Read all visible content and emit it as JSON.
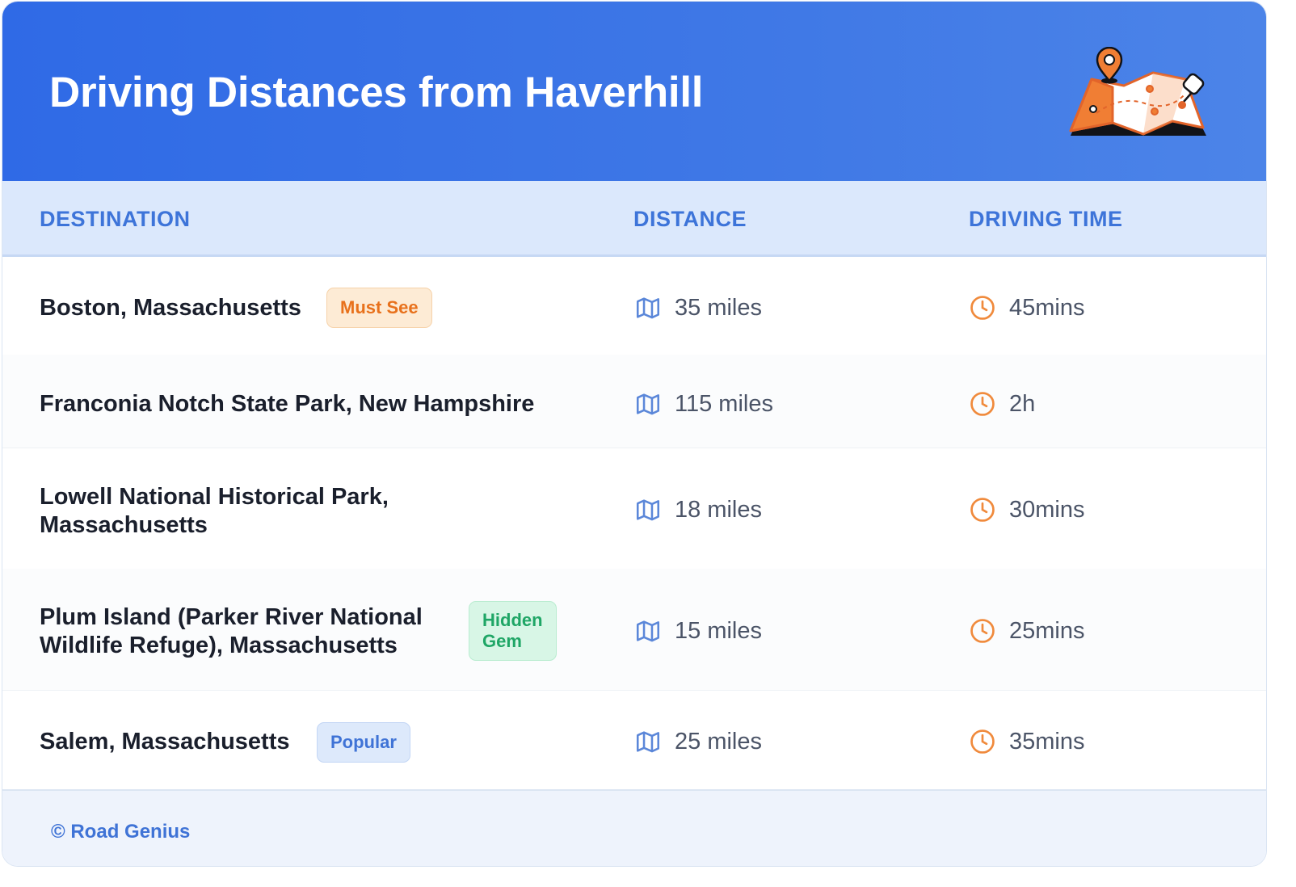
{
  "header": {
    "title": "Driving Distances from Haverhill",
    "illustration": "folded-map-with-pins-icon"
  },
  "table": {
    "columns": [
      "DESTINATION",
      "DISTANCE",
      "DRIVING TIME"
    ],
    "rows": [
      {
        "destination_line1": "Boston, Massachusetts",
        "destination_line2": "",
        "badge": "Must See",
        "badge_color": "#e8711c",
        "distance": "35 miles",
        "time": "45mins"
      },
      {
        "destination_line1": "Franconia Notch State Park, New Hampshire",
        "destination_line2": "",
        "badge": "",
        "distance": "115 miles",
        "time": "2h"
      },
      {
        "destination_line1": "Lowell National Historical Park,",
        "destination_line2": "Massachusetts",
        "badge": "",
        "distance": "18 miles",
        "time": "30mins"
      },
      {
        "destination_line1": "Plum Island (Parker River National",
        "destination_line2": "Wildlife Refuge), Massachusetts",
        "badge_line1": "Hidden",
        "badge_line2": "Gem",
        "badge_color": "#1fa666",
        "distance": "15 miles",
        "time": "25mins"
      },
      {
        "destination_line1": "Salem, Massachusetts",
        "destination_line2": "",
        "badge": "Popular",
        "badge_color": "#3f73d6",
        "distance": "25 miles",
        "time": "35mins"
      }
    ]
  },
  "icons": {
    "distance": "map-icon",
    "time": "clock-icon"
  },
  "colors": {
    "header": "#2f6ae6",
    "accent_blue": "#3d74d9",
    "accent_orange": "#f08a3c"
  },
  "footer": {
    "text": "© Road Genius"
  }
}
